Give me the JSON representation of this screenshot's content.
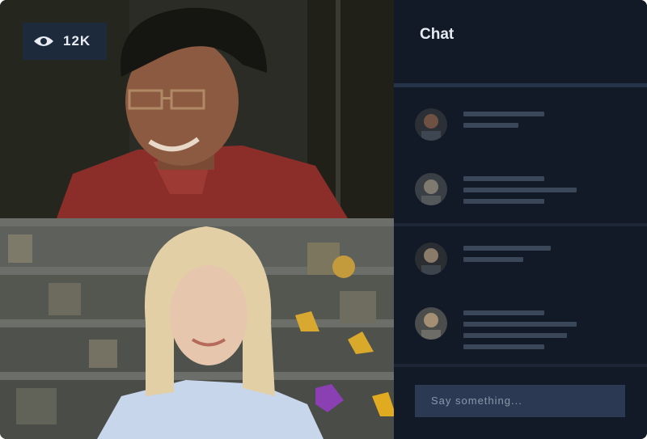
{
  "viewer_badge": {
    "icon": "eye-icon",
    "count": "12K"
  },
  "chat": {
    "title": "Chat",
    "messages": [
      {
        "avatar": "avatar-user-1",
        "lines": [
          100,
          68
        ]
      },
      {
        "avatar": "avatar-user-2",
        "lines": [
          100,
          140,
          100
        ]
      },
      {
        "avatar": "avatar-user-3",
        "lines": [
          108,
          74
        ]
      },
      {
        "avatar": "avatar-user-4",
        "lines": [
          100,
          140,
          128,
          100
        ]
      }
    ],
    "input_placeholder": "Say something..."
  },
  "colors": {
    "panel_bg": "#121a27",
    "accent_bar": "#26344a",
    "input_bg": "#2b3a52"
  }
}
